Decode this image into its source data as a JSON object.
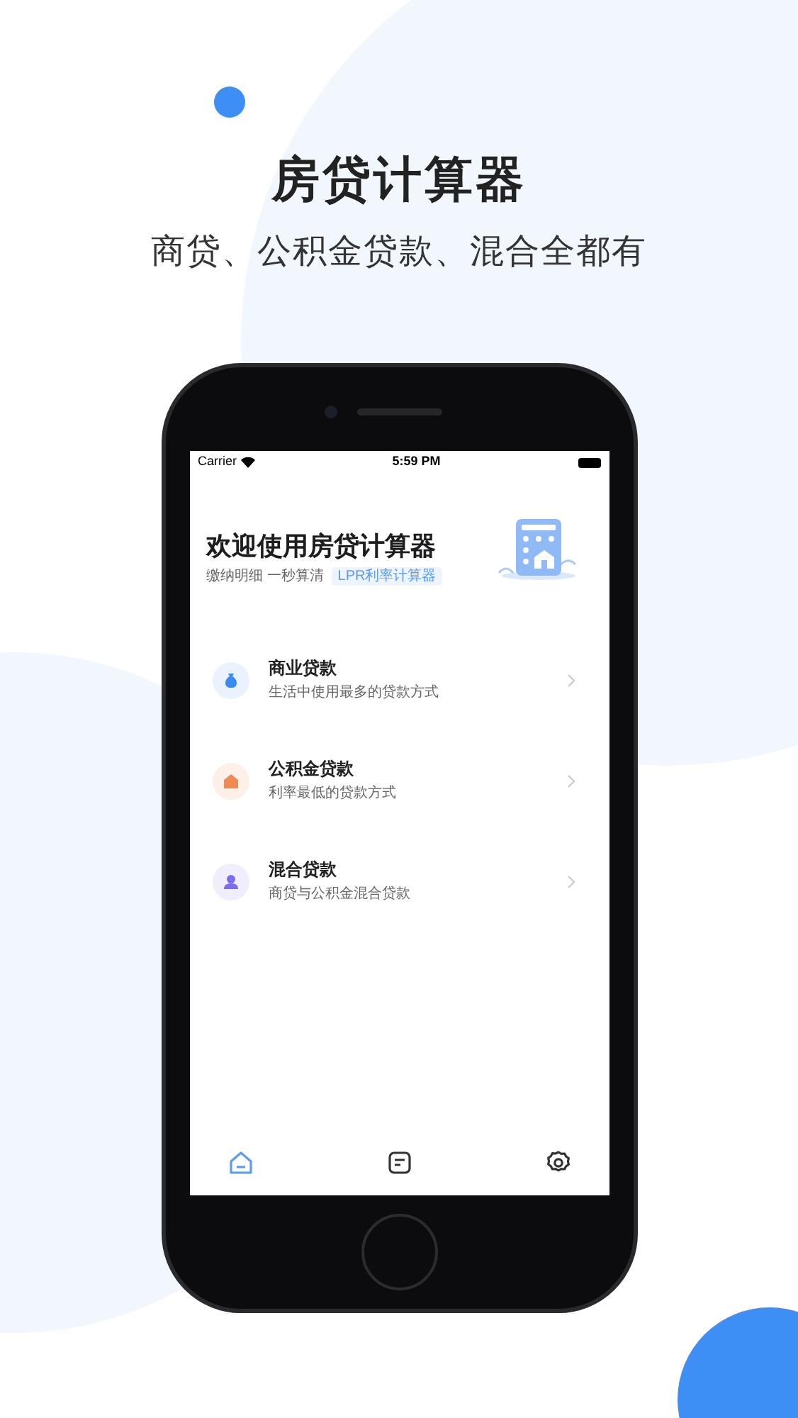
{
  "promo": {
    "title": "房贷计算器",
    "subtitle": "商贷、公积金贷款、混合全都有"
  },
  "status_bar": {
    "carrier": "Carrier",
    "time": "5:59 PM"
  },
  "header": {
    "title": "欢迎使用房贷计算器",
    "subtitle": "缴纳明细 一秒算清",
    "badge": "LPR利率计算器"
  },
  "loan_types": [
    {
      "title": "商业贷款",
      "description": "生活中使用最多的贷款方式",
      "color": "#3b8cf0"
    },
    {
      "title": "公积金贷款",
      "description": "利率最低的贷款方式",
      "color": "#f08a55"
    },
    {
      "title": "混合贷款",
      "description": "商贷与公积金混合贷款",
      "color": "#7c6cf0"
    }
  ],
  "tab_bar": [
    {
      "selected": true
    },
    {
      "selected": false
    },
    {
      "selected": false
    }
  ]
}
